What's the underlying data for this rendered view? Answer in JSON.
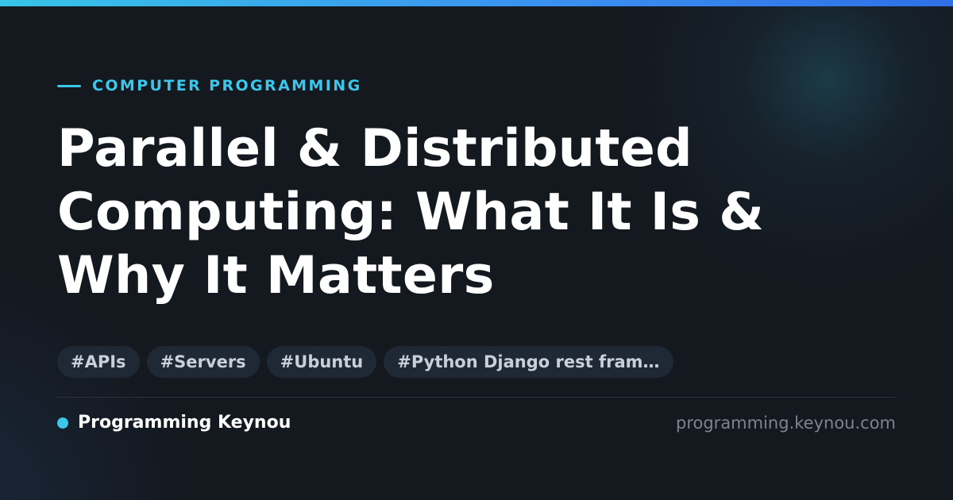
{
  "category": {
    "label": "COMPUTER PROGRAMMING"
  },
  "title": {
    "line1": "Parallel & Distributed",
    "line2": "Computing: What It Is &",
    "line3": "Why It Matters"
  },
  "tags": [
    {
      "label": "#APIs"
    },
    {
      "label": "#Servers"
    },
    {
      "label": "#Ubuntu"
    },
    {
      "label": "#Python Django rest fram…"
    }
  ],
  "footer": {
    "brand": "Programming Keynou",
    "url": "programming.keynou.com"
  },
  "colors": {
    "accent": "#3cc6ea",
    "background": "#14181f",
    "tag_background": "#1f2935",
    "muted_text": "#7b8592"
  }
}
